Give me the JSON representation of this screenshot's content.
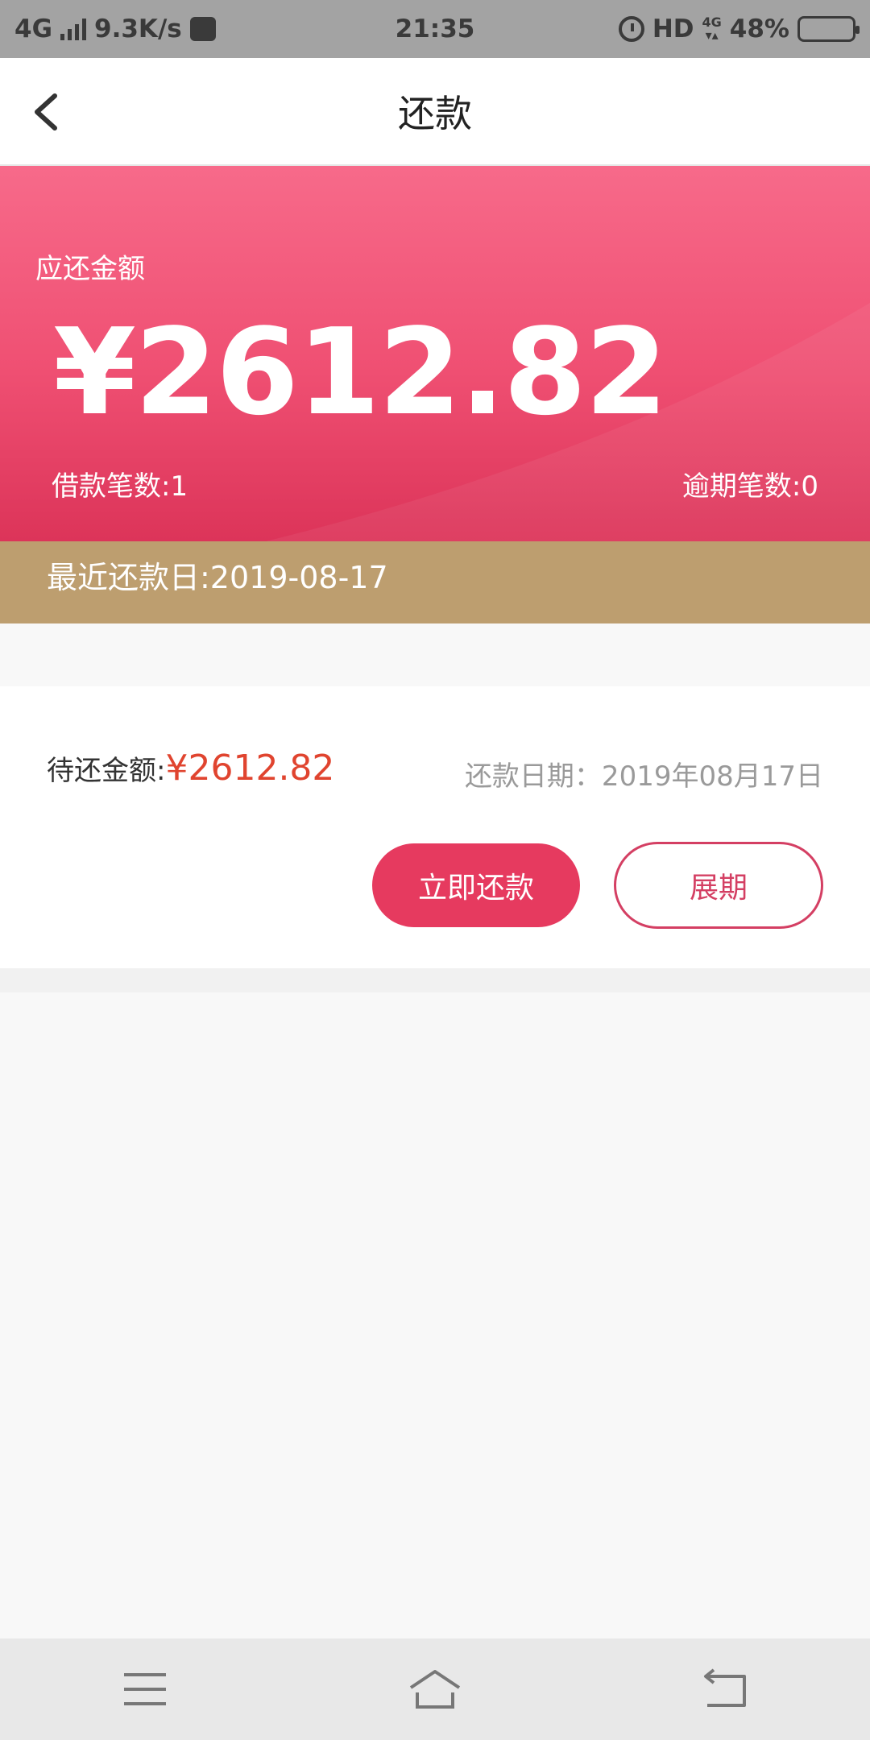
{
  "status_bar": {
    "network": "4G",
    "speed": "9.3K/s",
    "time": "21:35",
    "hd": "HD",
    "net_top": "4G",
    "battery": "48%",
    "battery_level": 0.48,
    "icons": [
      "signal-icon",
      "speed-app-icon",
      "alarm-icon",
      "battery-icon"
    ]
  },
  "nav": {
    "title": "还款",
    "back_icon": "chevron-left-icon"
  },
  "hero": {
    "label": "应还金额",
    "amount": "¥2612.82",
    "borrow_count": "借款笔数:1",
    "overdue_count": "逾期笔数:0"
  },
  "recent": {
    "text": "最近还款日:2019-08-17"
  },
  "bill": {
    "pending_label": "待还金额:",
    "pending_amount": "¥2612.82",
    "due_date": "还款日期：2019年08月17日",
    "pay_button": "立即还款",
    "extend_button": "展期"
  },
  "colors": {
    "accent": "#e63a5f",
    "gold": "#bd9e6f",
    "amount_red": "#e0442f"
  },
  "system_nav": {
    "icons": [
      "menu-icon",
      "home-icon",
      "back-icon"
    ]
  }
}
